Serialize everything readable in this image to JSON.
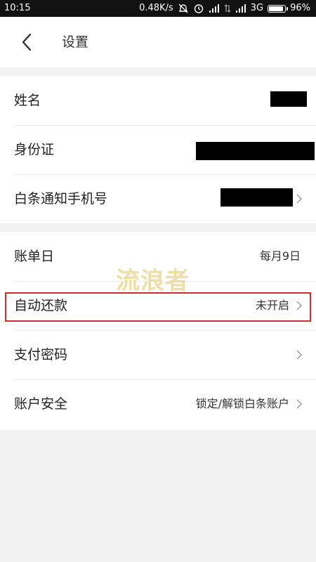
{
  "status_bar": {
    "time": "10:15",
    "net_speed": "0.48K/s",
    "network_type": "3G",
    "battery_percent": "96%",
    "battery_level": 0.96,
    "icons": [
      "alarm-off-icon",
      "clock-icon",
      "signal-icon",
      "data-arrows-icon",
      "signal-icon",
      "battery-icon"
    ]
  },
  "header": {
    "title": "设置",
    "back_icon": "chevron-left-icon"
  },
  "groups": {
    "profile": {
      "name_label": "姓名",
      "id_label": "身份证",
      "phone_label": "白条通知手机号"
    },
    "account": {
      "bill_day_label": "账单日",
      "bill_day_value": "每月9日",
      "auto_repay_label": "自动还款",
      "auto_repay_value": "未开启",
      "pay_password_label": "支付密码",
      "account_security_label": "账户安全",
      "account_security_value": "锁定/解锁白条账户"
    }
  },
  "watermark": "流浪者",
  "colors": {
    "status_bar_bg": "#121212",
    "page_bg": "#f2f2f2",
    "highlight": "#c9302c",
    "watermark": "#e8d58a"
  }
}
